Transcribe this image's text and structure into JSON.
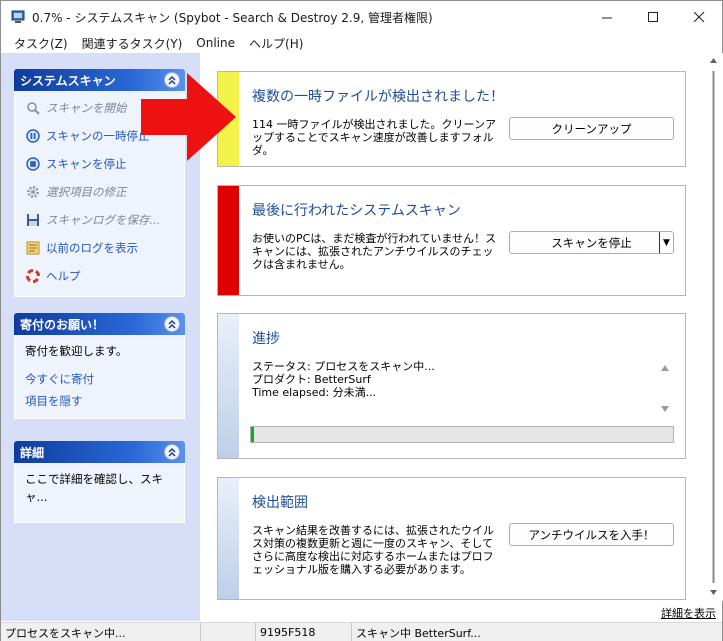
{
  "titlebar": {
    "title": "0.7% - システムスキャン (Spybot - Search & Destroy 2.9, 管理者権限)"
  },
  "menu": [
    "タスク(Z)",
    "関連するタスク(Y)",
    "Online",
    "ヘルプ(H)"
  ],
  "left": {
    "scan_box": {
      "header": "システムスキャン",
      "items": [
        {
          "label": "スキャンを開始",
          "icon": "search-icon",
          "disabled": true
        },
        {
          "label": "スキャンの一時停止",
          "icon": "pause-icon",
          "disabled": false
        },
        {
          "label": "スキャンを停止",
          "icon": "stop-icon",
          "disabled": false
        },
        {
          "label": "選択項目の修正",
          "icon": "gear-icon",
          "disabled": true
        },
        {
          "label": "スキャンログを保存...",
          "icon": "save-icon",
          "disabled": true
        },
        {
          "label": "以前のログを表示",
          "icon": "log-icon",
          "disabled": false
        },
        {
          "label": "ヘルプ",
          "icon": "lifebuoy-icon",
          "disabled": false
        }
      ]
    },
    "donate_box": {
      "header": "寄付のお願い！",
      "text": "寄付を歓迎します。",
      "link1": "今すぐに寄付",
      "link2": "項目を隠す"
    },
    "details_box": {
      "header": "詳細",
      "text": "ここで詳細を確認し、スキャ..."
    }
  },
  "panels": {
    "temp": {
      "title": "複数の一時ファイルが検出されました！",
      "text": "114 一時ファイルが検出されました。クリーンアップすることでスキャン速度が改善しますフォルダ。",
      "button": "クリーンアップ",
      "color": "#f2f24a"
    },
    "last_scan": {
      "title": "最後に行われたシステムスキャン",
      "text": "お使いのPCは、まだ検査が行われていません！スキャンには、拡張されたアンチウイルスのチェックは含まれません。",
      "button": "スキャンを停止",
      "color": "#e00000"
    },
    "progress": {
      "title": "進捗",
      "status": "ステータス: プロセスをスキャン中...",
      "product": "プロダクト: BetterSurf",
      "time": "Time elapsed: 分未満...",
      "progress": 0.007,
      "color": "#c5d6ec"
    },
    "coverage": {
      "title": "検出範囲",
      "text": "スキャン結果を改善するには、拡張されたウイルス対策の複数更新と週に一度のスキャン、そしてさらに高度な検出に対応するホームまたはプロフェッショナル版を購入する必要があります。",
      "button": "アンチウイルスを入手！"
    }
  },
  "details_link": "詳細を表示",
  "status": {
    "cell1": "プロセスをスキャン中...",
    "cell2": "",
    "cell3": "9195F518",
    "cell4": "スキャン中 BetterSurf..."
  }
}
